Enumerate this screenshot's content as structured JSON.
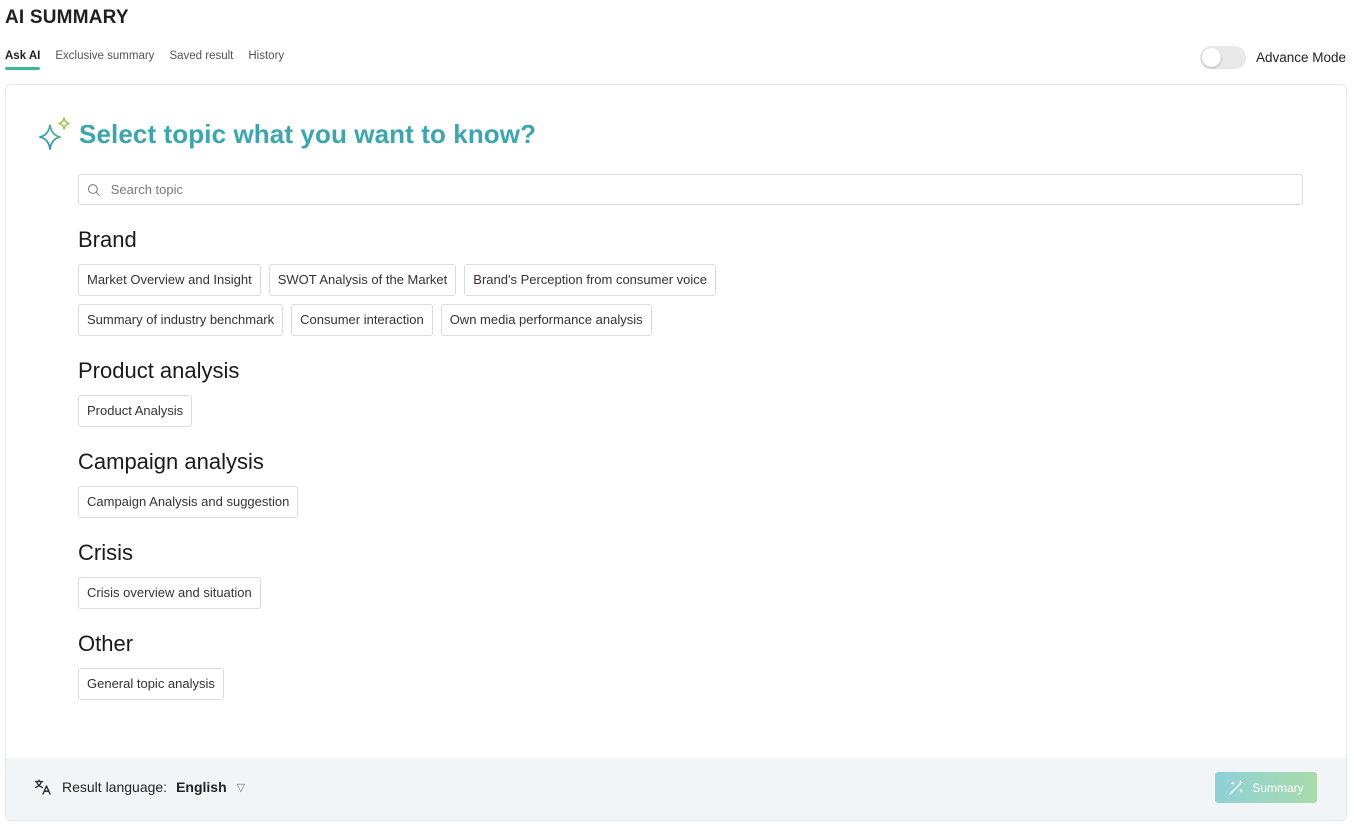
{
  "app": {
    "title": "AI SUMMARY"
  },
  "tabs": [
    {
      "label": "Ask AI",
      "active": true
    },
    {
      "label": "Exclusive summary",
      "active": false
    },
    {
      "label": "Saved result",
      "active": false
    },
    {
      "label": "History",
      "active": false
    }
  ],
  "advance_mode": {
    "label": "Advance Mode",
    "enabled": false
  },
  "main": {
    "heading": "Select topic what you want to know?",
    "search": {
      "placeholder": "Search topic",
      "value": ""
    }
  },
  "sections": [
    {
      "title": "Brand",
      "items": [
        "Market Overview and Insight",
        "SWOT Analysis of the Market",
        "Brand's Perception from consumer voice",
        "Summary of industry benchmark",
        "Consumer interaction",
        "Own media performance analysis"
      ]
    },
    {
      "title": "Product analysis",
      "items": [
        "Product Analysis"
      ]
    },
    {
      "title": "Campaign analysis",
      "items": [
        "Campaign Analysis and suggestion"
      ]
    },
    {
      "title": "Crisis",
      "items": [
        "Crisis overview and situation"
      ]
    },
    {
      "title": "Other",
      "items": [
        "General topic analysis"
      ]
    }
  ],
  "footer": {
    "language_label": "Result language:",
    "language_value": "English",
    "summary_label": "Summary"
  },
  "colors": {
    "accent": "#3aa6b0",
    "tab_indicator": "#3fb89a",
    "footer_bg": "#f2f5f8"
  },
  "icons": {
    "heading": "sparkle-icon",
    "search": "search-icon",
    "language": "translate-icon",
    "dropdown": "caret-down-icon",
    "summary": "magic-wand-icon"
  }
}
